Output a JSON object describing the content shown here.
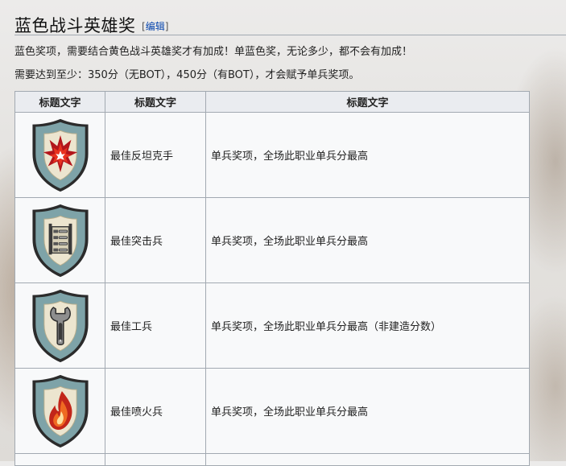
{
  "section": {
    "title": "蓝色战斗英雄奖",
    "edit_open": "[",
    "edit_label": "编辑",
    "edit_close": "]"
  },
  "paragraphs": {
    "p1": "蓝色奖项，需要结合黄色战斗英雄奖才有加成！单蓝色奖，无论多少，都不会有加成！",
    "p2": "需要达到至少：350分（无BOT），450分（有BOT），才会赋予单兵奖项。"
  },
  "table": {
    "headers": [
      "标题文字",
      "标题文字",
      "标题文字"
    ],
    "rows": [
      {
        "icon": "explosion-shield-icon",
        "name": "最佳反坦克手",
        "desc": "单兵奖项，全场此职业单兵分最高"
      },
      {
        "icon": "ammo-shield-icon",
        "name": "最佳突击兵",
        "desc": "单兵奖项，全场此职业单兵分最高"
      },
      {
        "icon": "wrench-shield-icon",
        "name": "最佳工兵",
        "desc": "单兵奖项，全场此职业单兵分最高（非建造分数）"
      },
      {
        "icon": "flame-shield-icon",
        "name": "最佳喷火兵",
        "desc": "单兵奖项，全场此职业单兵分最高"
      }
    ]
  },
  "colors": {
    "shield_outer": "#7ea3a8",
    "shield_rim": "#2b2b2b",
    "shield_inner": "#ece5cf",
    "link": "#0645ad",
    "header_bg": "#eaecf0",
    "border": "#a2a9b1"
  }
}
